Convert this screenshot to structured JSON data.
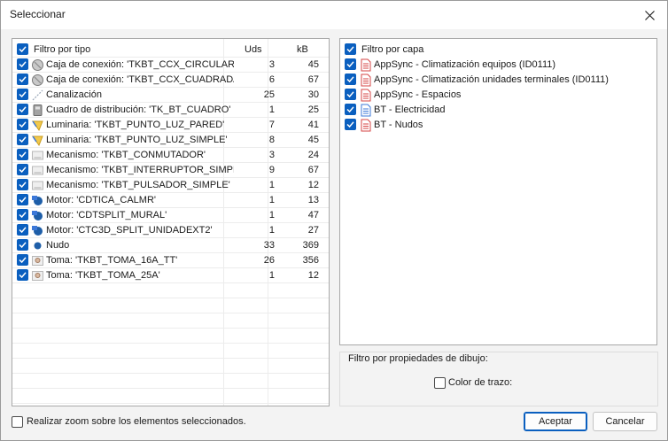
{
  "window": {
    "title": "Seleccionar"
  },
  "type_filter": {
    "header": "Filtro por tipo",
    "col_uds": "Uds",
    "col_kb": "kB",
    "rows": [
      {
        "name": "Caja de conexión: 'TKBT_CCX_CIRCULAR'",
        "uds": "3",
        "kb": "45",
        "icon": "junction-box-icon",
        "checked": true
      },
      {
        "name": "Caja de conexión: 'TKBT_CCX_CUADRADA'",
        "uds": "6",
        "kb": "67",
        "icon": "junction-box-icon",
        "checked": true
      },
      {
        "name": "Canalización",
        "uds": "25",
        "kb": "30",
        "icon": "conduit-icon",
        "checked": true
      },
      {
        "name": "Cuadro de distribución: 'TK_BT_CUADRO'",
        "uds": "1",
        "kb": "25",
        "icon": "distribution-board-icon",
        "checked": true
      },
      {
        "name": "Luminaria: 'TKBT_PUNTO_LUZ_PARED'",
        "uds": "7",
        "kb": "41",
        "icon": "luminaire-icon",
        "checked": true
      },
      {
        "name": "Luminaria: 'TKBT_PUNTO_LUZ_SIMPLE'",
        "uds": "8",
        "kb": "45",
        "icon": "luminaire-icon",
        "checked": true
      },
      {
        "name": "Mecanismo: 'TKBT_CONMUTADOR'",
        "uds": "3",
        "kb": "24",
        "icon": "switch-mechanism-icon",
        "checked": true
      },
      {
        "name": "Mecanismo: 'TKBT_INTERRUPTOR_SIMPLE'",
        "uds": "9",
        "kb": "67",
        "icon": "switch-mechanism-icon",
        "checked": true
      },
      {
        "name": "Mecanismo: 'TKBT_PULSADOR_SIMPLE'",
        "uds": "1",
        "kb": "12",
        "icon": "switch-mechanism-icon",
        "checked": true
      },
      {
        "name": "Motor: 'CDTICA_CALMR'",
        "uds": "1",
        "kb": "13",
        "icon": "motor-icon",
        "checked": true
      },
      {
        "name": "Motor: 'CDTSPLIT_MURAL'",
        "uds": "1",
        "kb": "47",
        "icon": "motor-icon",
        "checked": true
      },
      {
        "name": "Motor: 'CTC3D_SPLIT_UNIDADEXT2'",
        "uds": "1",
        "kb": "27",
        "icon": "motor-icon",
        "checked": true
      },
      {
        "name": "Nudo",
        "uds": "33",
        "kb": "369",
        "icon": "node-icon",
        "checked": true
      },
      {
        "name": "Toma: 'TKBT_TOMA_16A_TT'",
        "uds": "26",
        "kb": "356",
        "icon": "socket-icon",
        "checked": true
      },
      {
        "name": "Toma: 'TKBT_TOMA_25A'",
        "uds": "1",
        "kb": "12",
        "icon": "socket-icon",
        "checked": true
      }
    ]
  },
  "layer_filter": {
    "header": "Filtro por capa",
    "layers": [
      {
        "label": "AppSync - Climatización equipos (ID0111)",
        "icon": "layer-red-doc-icon",
        "checked": true
      },
      {
        "label": "AppSync - Climatización unidades terminales (ID0111)",
        "icon": "layer-red-doc-icon",
        "checked": true
      },
      {
        "label": "AppSync - Espacios",
        "icon": "layer-red-doc-icon",
        "checked": true
      },
      {
        "label": "BT - Electricidad",
        "icon": "layer-blue-doc-icon",
        "checked": true
      },
      {
        "label": "BT - Nudos",
        "icon": "layer-red-doc-icon",
        "checked": true
      }
    ]
  },
  "drawing_props": {
    "title": "Filtro por propiedades de dibujo:",
    "trace_color_label": "Color de trazo:"
  },
  "zoom_option": {
    "label": "Realizar zoom sobre los elementos seleccionados."
  },
  "buttons": {
    "accept": "Aceptar",
    "cancel": "Cancelar"
  },
  "colors": {
    "accent": "#0a5fbf",
    "layer_red": "#d64545",
    "layer_blue": "#3c78d8"
  }
}
